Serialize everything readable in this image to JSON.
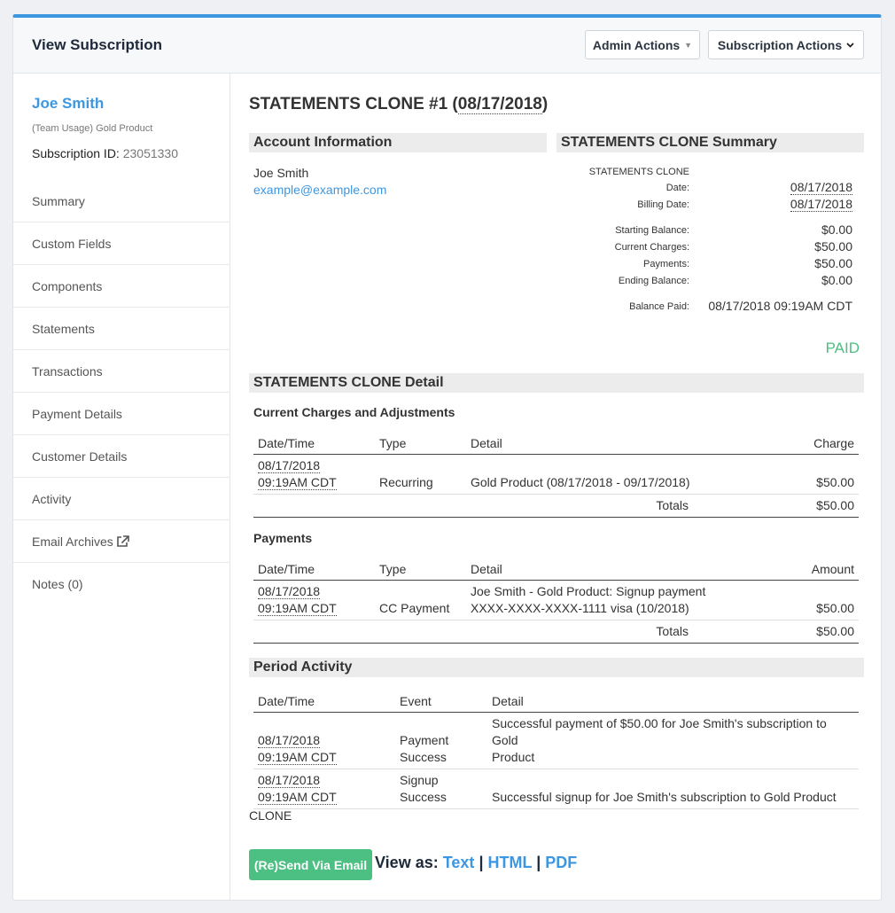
{
  "header": {
    "title": "View Subscription",
    "admin_actions": "Admin Actions",
    "subscription_actions": "Subscription Actions"
  },
  "sidebar": {
    "customer_name": "Joe Smith",
    "product": "(Team Usage) Gold Product",
    "subscription_id_label": "Subscription ID:",
    "subscription_id": "23051330",
    "items": [
      {
        "label": "Summary"
      },
      {
        "label": "Custom Fields"
      },
      {
        "label": "Components"
      },
      {
        "label": "Statements"
      },
      {
        "label": "Transactions"
      },
      {
        "label": "Payment Details"
      },
      {
        "label": "Customer Details"
      },
      {
        "label": "Activity"
      },
      {
        "label": "Email Archives"
      },
      {
        "label": "Notes (0)"
      }
    ]
  },
  "statement": {
    "title_prefix": "STATEMENTS CLONE #1 (",
    "title_date": "08/17/2018",
    "title_suffix": ")",
    "account_header": "Account Information",
    "account_name": "Joe Smith",
    "account_email": "example@example.com",
    "summary_header": "STATEMENTS CLONE Summary",
    "summary": {
      "kind_label": "STATEMENTS CLONE",
      "date_label": "Date:",
      "date": "08/17/2018",
      "billing_date_label": "Billing Date:",
      "billing_date": "08/17/2018",
      "starting_balance_label": "Starting Balance:",
      "starting_balance": "$0.00",
      "current_charges_label": "Current Charges:",
      "current_charges": "$50.00",
      "payments_label": "Payments:",
      "payments": "$50.00",
      "ending_balance_label": "Ending Balance:",
      "ending_balance": "$0.00",
      "balance_paid_label": "Balance Paid:",
      "balance_paid": "08/17/2018 09:19AM CDT",
      "status": "PAID"
    },
    "detail_header": "STATEMENTS CLONE Detail",
    "charges": {
      "header": "Current Charges and Adjustments",
      "columns": [
        "Date/Time",
        "Type",
        "Detail",
        "Charge"
      ],
      "rows": [
        {
          "date": "08/17/2018",
          "time": "09:19AM CDT",
          "type": "Recurring",
          "detail": "Gold Product (08/17/2018 - 09/17/2018)",
          "amount": "$50.00"
        }
      ],
      "totals_label": "Totals",
      "total": "$50.00"
    },
    "payments": {
      "header": "Payments",
      "columns": [
        "Date/Time",
        "Type",
        "Detail",
        "Amount"
      ],
      "rows": [
        {
          "date": "08/17/2018",
          "time": "09:19AM CDT",
          "type": "CC Payment",
          "detail_line1": "Joe Smith - Gold Product: Signup payment",
          "detail_line2": "XXXX-XXXX-XXXX-1111 visa (10/2018)",
          "amount": "$50.00"
        }
      ],
      "totals_label": "Totals",
      "total": "$50.00"
    },
    "period_activity": {
      "header": "Period Activity",
      "columns": [
        "Date/Time",
        "Event",
        "Detail"
      ],
      "rows": [
        {
          "date": "08/17/2018",
          "time": "09:19AM CDT",
          "event_line1": "Payment",
          "event_line2": "Success",
          "detail_line1": "Successful payment of $50.00 for Joe Smith's subscription to Gold",
          "detail_line2": "Product"
        },
        {
          "date": "08/17/2018",
          "time": "09:19AM CDT",
          "event_line1": "",
          "event_line2": "Signup Success",
          "detail_line1": "",
          "detail_line2": "Successful signup for Joe Smith's subscription to Gold Product"
        }
      ]
    },
    "footer_note": "CLONE",
    "resend_button": "(Re)Send Via Email",
    "view_as_label": "View as:",
    "view_as_links": [
      "Text",
      "HTML",
      "PDF"
    ],
    "view_as_separator": "|"
  },
  "colors": {
    "accent": "#3d97e0",
    "paid": "#4cbf82",
    "button_green": "#4cbf82"
  },
  "icons": {
    "admin_caret": "caret-down-icon",
    "subscription_chevron": "chevron-down-icon",
    "email_archives": "external-link-icon"
  }
}
